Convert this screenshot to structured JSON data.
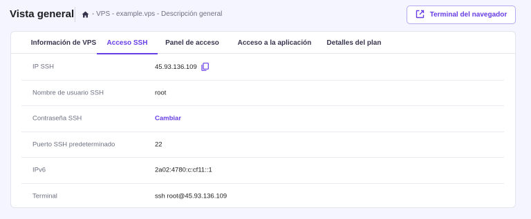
{
  "header": {
    "title": "Vista general",
    "breadcrumb": "- VPS - example.vps - Descripción general",
    "terminal_button": "Terminal del navegador"
  },
  "tabs": [
    {
      "label": "Información de VPS",
      "active": false
    },
    {
      "label": "Acceso SSH",
      "active": true
    },
    {
      "label": "Panel de acceso",
      "active": false
    },
    {
      "label": "Acceso a la aplicación",
      "active": false
    },
    {
      "label": "Detalles del plan",
      "active": false
    }
  ],
  "rows": [
    {
      "label": "IP SSH",
      "value": "45.93.136.109"
    },
    {
      "label": "Nombre de usuario SSH",
      "value": "root"
    },
    {
      "label": "Contraseña SSH",
      "value": "Cambiar"
    },
    {
      "label": "Puerto SSH predeterminado",
      "value": "22"
    },
    {
      "label": "IPv6",
      "value": "2a02:4780:c:cf11::1"
    },
    {
      "label": "Terminal",
      "value": "ssh root@45.93.136.109"
    }
  ],
  "colors": {
    "accent": "#673de6",
    "background": "#f4f5ff",
    "text": "#1d1e20",
    "muted": "#6d7081"
  },
  "icons": {
    "breadcrumb": "home-icon",
    "terminal_button": "external-link-icon",
    "ip_row": "copy-icon"
  }
}
